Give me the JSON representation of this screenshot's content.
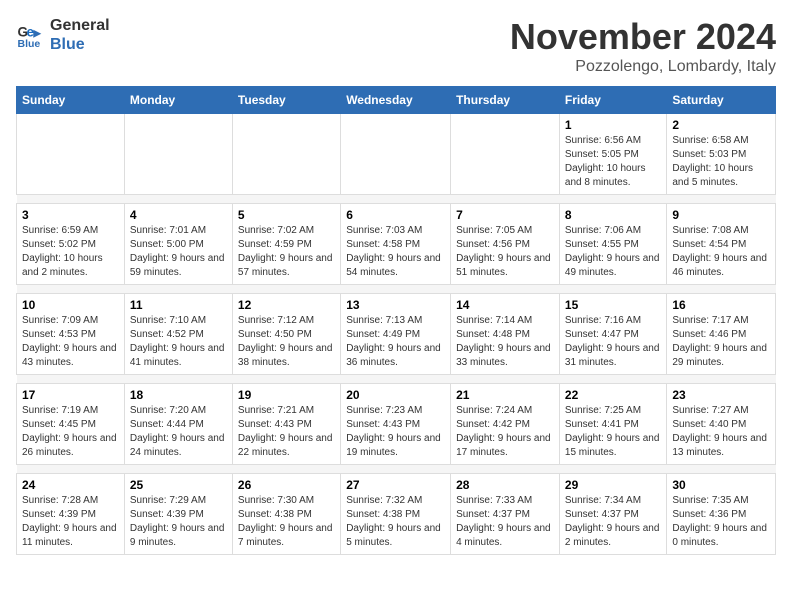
{
  "logo": {
    "line1": "General",
    "line2": "Blue"
  },
  "title": "November 2024",
  "subtitle": "Pozzolengo, Lombardy, Italy",
  "weekdays": [
    "Sunday",
    "Monday",
    "Tuesday",
    "Wednesday",
    "Thursday",
    "Friday",
    "Saturday"
  ],
  "weeks": [
    [
      {
        "day": "",
        "info": ""
      },
      {
        "day": "",
        "info": ""
      },
      {
        "day": "",
        "info": ""
      },
      {
        "day": "",
        "info": ""
      },
      {
        "day": "",
        "info": ""
      },
      {
        "day": "1",
        "info": "Sunrise: 6:56 AM\nSunset: 5:05 PM\nDaylight: 10 hours and 8 minutes."
      },
      {
        "day": "2",
        "info": "Sunrise: 6:58 AM\nSunset: 5:03 PM\nDaylight: 10 hours and 5 minutes."
      }
    ],
    [
      {
        "day": "3",
        "info": "Sunrise: 6:59 AM\nSunset: 5:02 PM\nDaylight: 10 hours and 2 minutes."
      },
      {
        "day": "4",
        "info": "Sunrise: 7:01 AM\nSunset: 5:00 PM\nDaylight: 9 hours and 59 minutes."
      },
      {
        "day": "5",
        "info": "Sunrise: 7:02 AM\nSunset: 4:59 PM\nDaylight: 9 hours and 57 minutes."
      },
      {
        "day": "6",
        "info": "Sunrise: 7:03 AM\nSunset: 4:58 PM\nDaylight: 9 hours and 54 minutes."
      },
      {
        "day": "7",
        "info": "Sunrise: 7:05 AM\nSunset: 4:56 PM\nDaylight: 9 hours and 51 minutes."
      },
      {
        "day": "8",
        "info": "Sunrise: 7:06 AM\nSunset: 4:55 PM\nDaylight: 9 hours and 49 minutes."
      },
      {
        "day": "9",
        "info": "Sunrise: 7:08 AM\nSunset: 4:54 PM\nDaylight: 9 hours and 46 minutes."
      }
    ],
    [
      {
        "day": "10",
        "info": "Sunrise: 7:09 AM\nSunset: 4:53 PM\nDaylight: 9 hours and 43 minutes."
      },
      {
        "day": "11",
        "info": "Sunrise: 7:10 AM\nSunset: 4:52 PM\nDaylight: 9 hours and 41 minutes."
      },
      {
        "day": "12",
        "info": "Sunrise: 7:12 AM\nSunset: 4:50 PM\nDaylight: 9 hours and 38 minutes."
      },
      {
        "day": "13",
        "info": "Sunrise: 7:13 AM\nSunset: 4:49 PM\nDaylight: 9 hours and 36 minutes."
      },
      {
        "day": "14",
        "info": "Sunrise: 7:14 AM\nSunset: 4:48 PM\nDaylight: 9 hours and 33 minutes."
      },
      {
        "day": "15",
        "info": "Sunrise: 7:16 AM\nSunset: 4:47 PM\nDaylight: 9 hours and 31 minutes."
      },
      {
        "day": "16",
        "info": "Sunrise: 7:17 AM\nSunset: 4:46 PM\nDaylight: 9 hours and 29 minutes."
      }
    ],
    [
      {
        "day": "17",
        "info": "Sunrise: 7:19 AM\nSunset: 4:45 PM\nDaylight: 9 hours and 26 minutes."
      },
      {
        "day": "18",
        "info": "Sunrise: 7:20 AM\nSunset: 4:44 PM\nDaylight: 9 hours and 24 minutes."
      },
      {
        "day": "19",
        "info": "Sunrise: 7:21 AM\nSunset: 4:43 PM\nDaylight: 9 hours and 22 minutes."
      },
      {
        "day": "20",
        "info": "Sunrise: 7:23 AM\nSunset: 4:43 PM\nDaylight: 9 hours and 19 minutes."
      },
      {
        "day": "21",
        "info": "Sunrise: 7:24 AM\nSunset: 4:42 PM\nDaylight: 9 hours and 17 minutes."
      },
      {
        "day": "22",
        "info": "Sunrise: 7:25 AM\nSunset: 4:41 PM\nDaylight: 9 hours and 15 minutes."
      },
      {
        "day": "23",
        "info": "Sunrise: 7:27 AM\nSunset: 4:40 PM\nDaylight: 9 hours and 13 minutes."
      }
    ],
    [
      {
        "day": "24",
        "info": "Sunrise: 7:28 AM\nSunset: 4:39 PM\nDaylight: 9 hours and 11 minutes."
      },
      {
        "day": "25",
        "info": "Sunrise: 7:29 AM\nSunset: 4:39 PM\nDaylight: 9 hours and 9 minutes."
      },
      {
        "day": "26",
        "info": "Sunrise: 7:30 AM\nSunset: 4:38 PM\nDaylight: 9 hours and 7 minutes."
      },
      {
        "day": "27",
        "info": "Sunrise: 7:32 AM\nSunset: 4:38 PM\nDaylight: 9 hours and 5 minutes."
      },
      {
        "day": "28",
        "info": "Sunrise: 7:33 AM\nSunset: 4:37 PM\nDaylight: 9 hours and 4 minutes."
      },
      {
        "day": "29",
        "info": "Sunrise: 7:34 AM\nSunset: 4:37 PM\nDaylight: 9 hours and 2 minutes."
      },
      {
        "day": "30",
        "info": "Sunrise: 7:35 AM\nSunset: 4:36 PM\nDaylight: 9 hours and 0 minutes."
      }
    ]
  ]
}
